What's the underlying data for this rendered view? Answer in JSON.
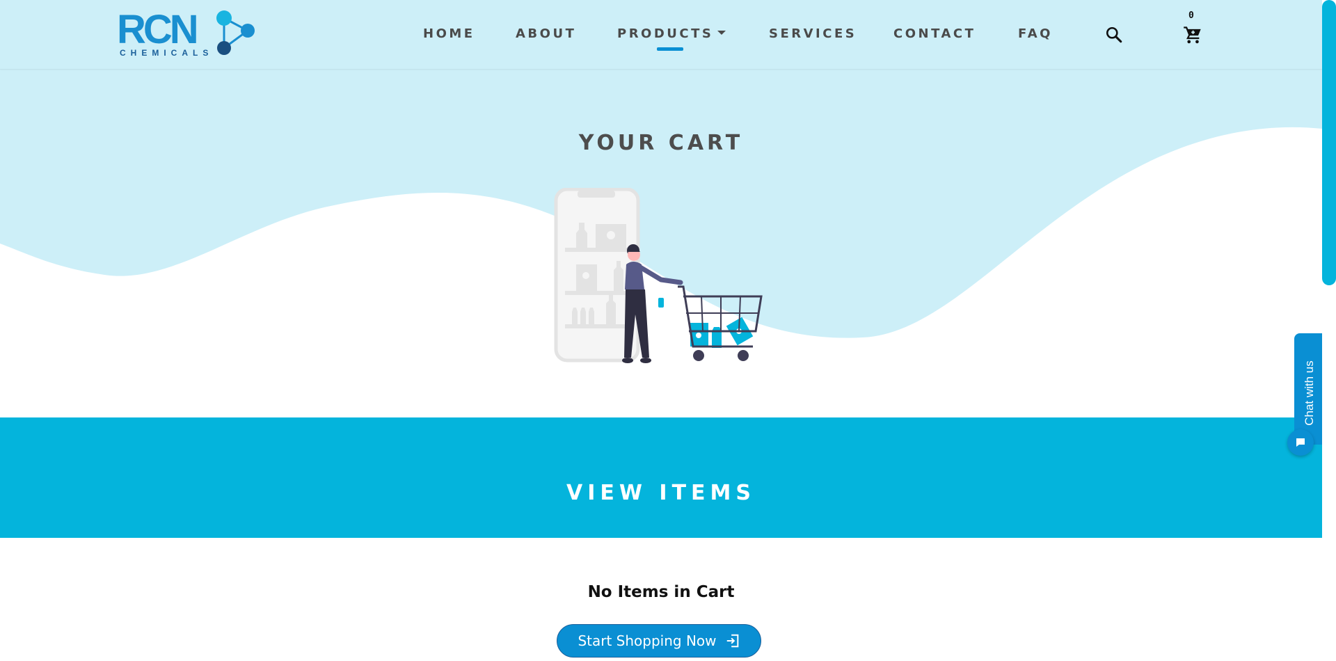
{
  "brand": {
    "logo_text": "RCN",
    "logo_subtext": "CHEMICALS",
    "primary_color": "#0a8fd3",
    "accent_color": "#04b4dc",
    "hero_tint": "#cdeff8"
  },
  "nav": {
    "items": [
      {
        "label": "HOME"
      },
      {
        "label": "ABOUT"
      },
      {
        "label": "PRODUCTS",
        "has_dropdown": true,
        "active": true
      },
      {
        "label": "SERVICES"
      },
      {
        "label": "CONTACT"
      },
      {
        "label": "FAQ"
      }
    ],
    "search_icon": "search-icon",
    "cart_icon": "shopping-cart-icon",
    "cart_count": "0"
  },
  "hero": {
    "title": "YOUR CART"
  },
  "items_section": {
    "title": "VIEW ITEMS",
    "empty_message": "No Items in Cart",
    "cta_label": "Start Shopping Now",
    "cta_icon": "enter-icon"
  },
  "chat": {
    "tab_label": "Chat with us",
    "bubble_icon": "chat-bubble-icon"
  }
}
